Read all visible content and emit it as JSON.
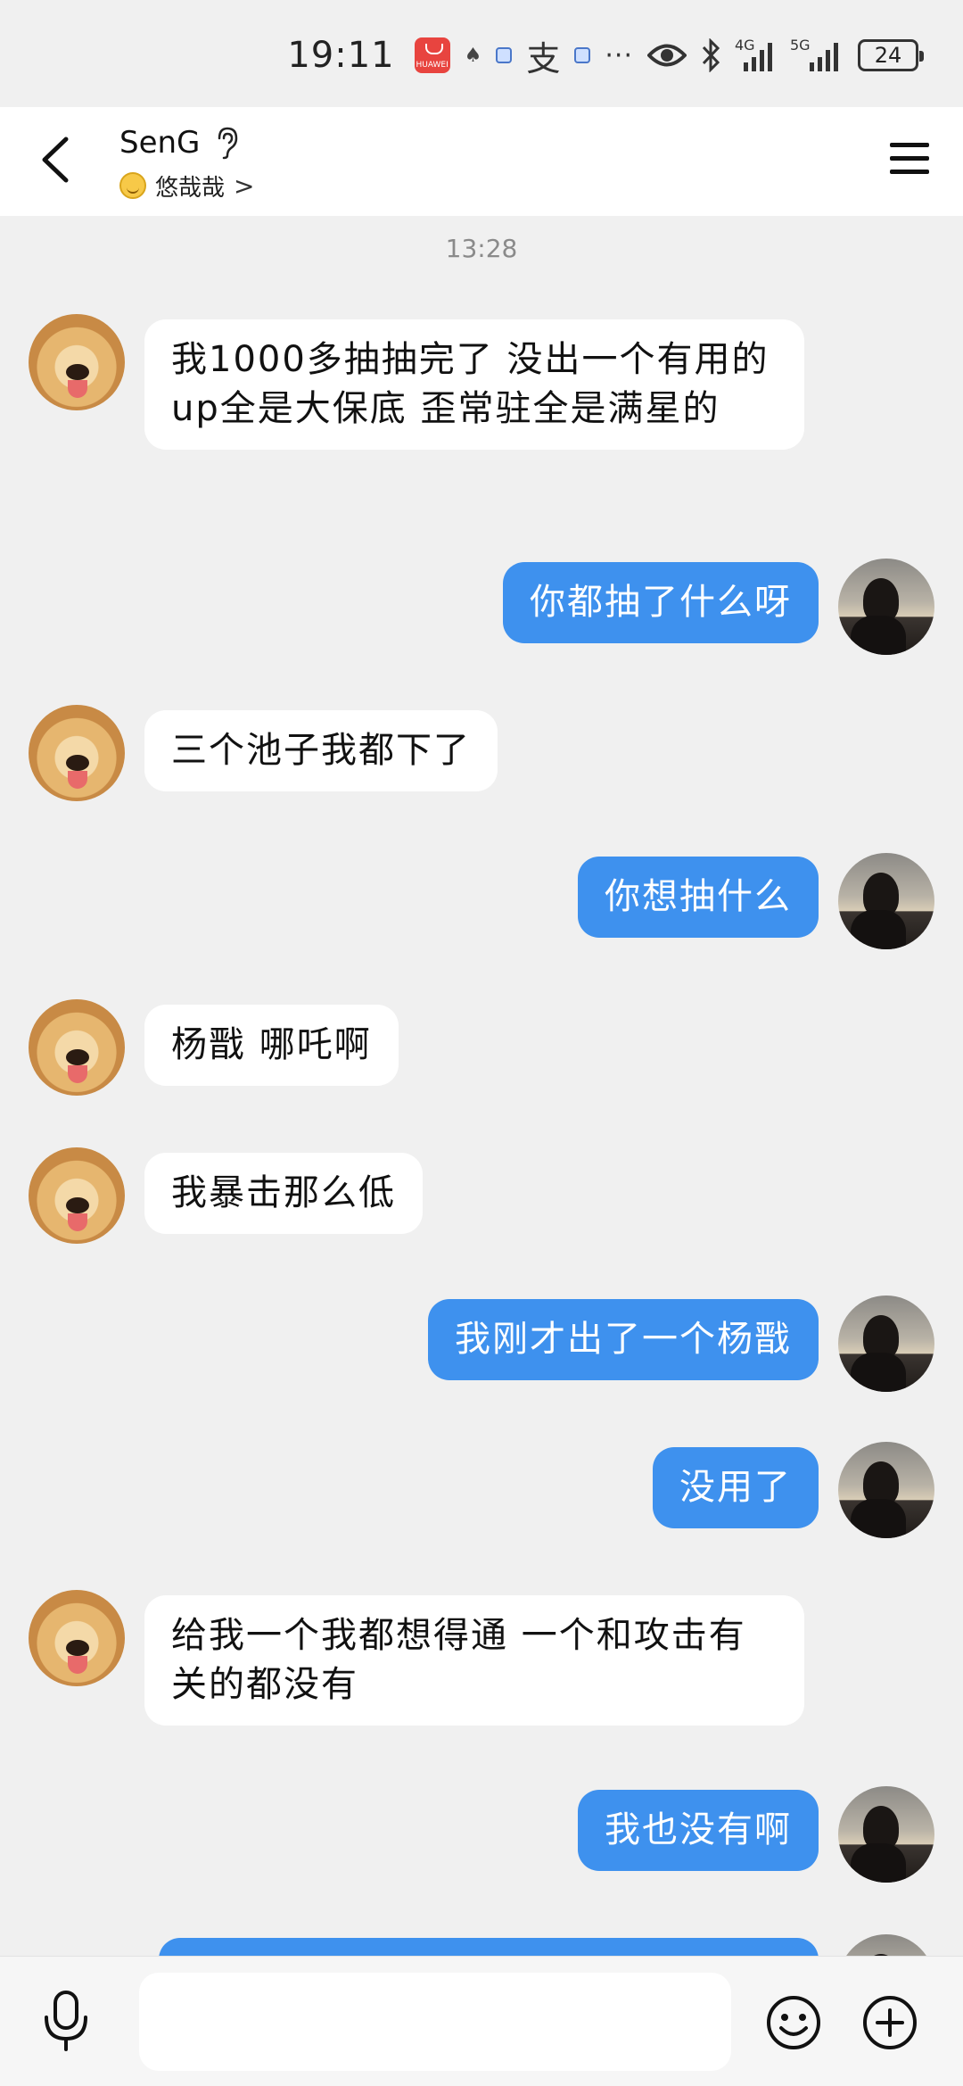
{
  "status_bar": {
    "time": "19:11",
    "app_icon_label": "HUAWEI",
    "more": "···",
    "network_4g": "4G",
    "network_5g": "5G",
    "battery": "24"
  },
  "header": {
    "contact_name": "SenG",
    "status_text": "悠哉哉",
    "status_chevron": ">"
  },
  "chat": {
    "timestamp": "13:28",
    "messages": [
      {
        "from": "other",
        "text": "我1000多抽抽完了 没出一个有用的 up全是大保底 歪常驻全是满星的"
      },
      {
        "from": "me",
        "text": "你都抽了什么呀"
      },
      {
        "from": "other",
        "text": "三个池子我都下了"
      },
      {
        "from": "me",
        "text": "你想抽什么"
      },
      {
        "from": "other",
        "text": "杨戬 哪吒啊"
      },
      {
        "from": "other",
        "text": "我暴击那么低"
      },
      {
        "from": "me",
        "text": "我刚才出了一个杨戬"
      },
      {
        "from": "me",
        "text": "没用了"
      },
      {
        "from": "other",
        "text": "给我一个我都想得通 一个和攻击有关的都没有"
      },
      {
        "from": "me",
        "text": "我也没有啊"
      },
      {
        "from": "me",
        "text": ""
      }
    ]
  },
  "input_bar": {
    "placeholder": ""
  },
  "colors": {
    "outgoing_bubble": "#3e91ee",
    "incoming_bubble": "#ffffff",
    "background": "#f0f0f0"
  },
  "icons": [
    "back-arrow-icon",
    "ear-icon",
    "menu-icon",
    "microphone-icon",
    "emoji-icon",
    "plus-icon",
    "eye-icon",
    "bluetooth-icon",
    "signal-icon",
    "battery-icon"
  ]
}
